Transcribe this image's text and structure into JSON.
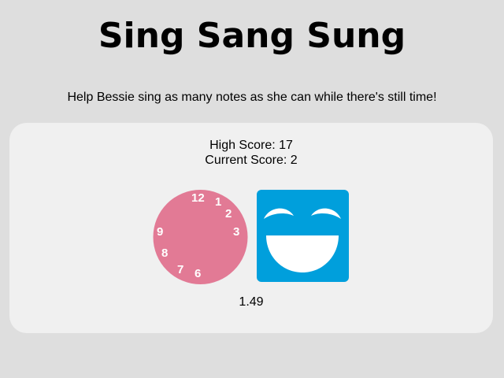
{
  "title": "Sing Sang Sung",
  "subtitle": "Help Bessie sing as many notes as she can while there's still time!",
  "scores": {
    "high_label": "High Score: 17",
    "current_label": "Current Score: 2"
  },
  "clock": {
    "numbers": [
      "12",
      "1",
      "2",
      "3",
      "9",
      "8",
      "7",
      "6"
    ],
    "color": "#e27a95"
  },
  "face": {
    "icon": "laughing-face-icon",
    "color": "#009fdc"
  },
  "timer": "1.49",
  "colors": {
    "background": "#dedede",
    "panel": "#f0f0f0"
  }
}
